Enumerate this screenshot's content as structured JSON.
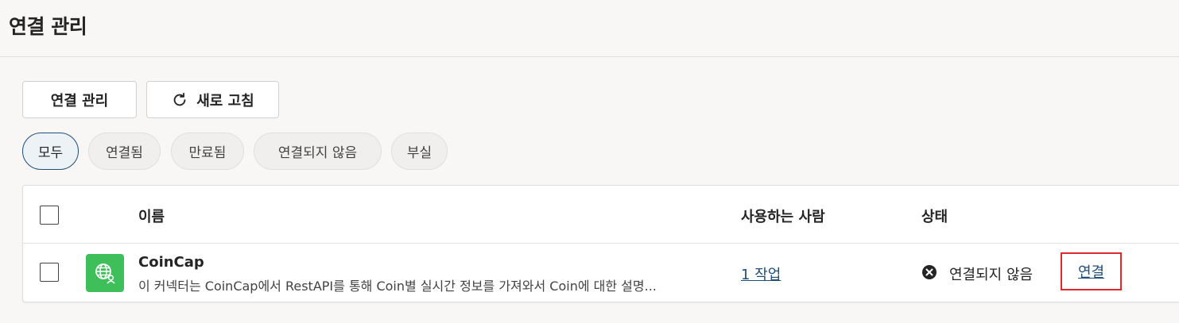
{
  "header": {
    "title": "연결 관리"
  },
  "toolbar": {
    "manage_label": "연결 관리",
    "refresh_label": "새로 고침"
  },
  "filters": [
    {
      "label": "모두",
      "active": true
    },
    {
      "label": "연결됨",
      "active": false
    },
    {
      "label": "만료됨",
      "active": false
    },
    {
      "label": "연결되지 않음",
      "active": false
    },
    {
      "label": "부실",
      "active": false
    }
  ],
  "table": {
    "columns": {
      "name": "이름",
      "used_by": "사용하는 사람",
      "status": "상태"
    },
    "rows": [
      {
        "icon": "globe-person-icon",
        "name": "CoinCap",
        "description": "이 커넥터는 CoinCap에서 RestAPI를 통해 Coin별 실시간 정보를 가져와서 Coin에 대한 설명...",
        "used_by": "1 작업",
        "status": "연결되지 않음",
        "action": "연결"
      }
    ]
  },
  "colors": {
    "accent": "#1f4e79",
    "app_icon_bg": "#3fbf5a",
    "highlight_border": "#e0282e"
  }
}
